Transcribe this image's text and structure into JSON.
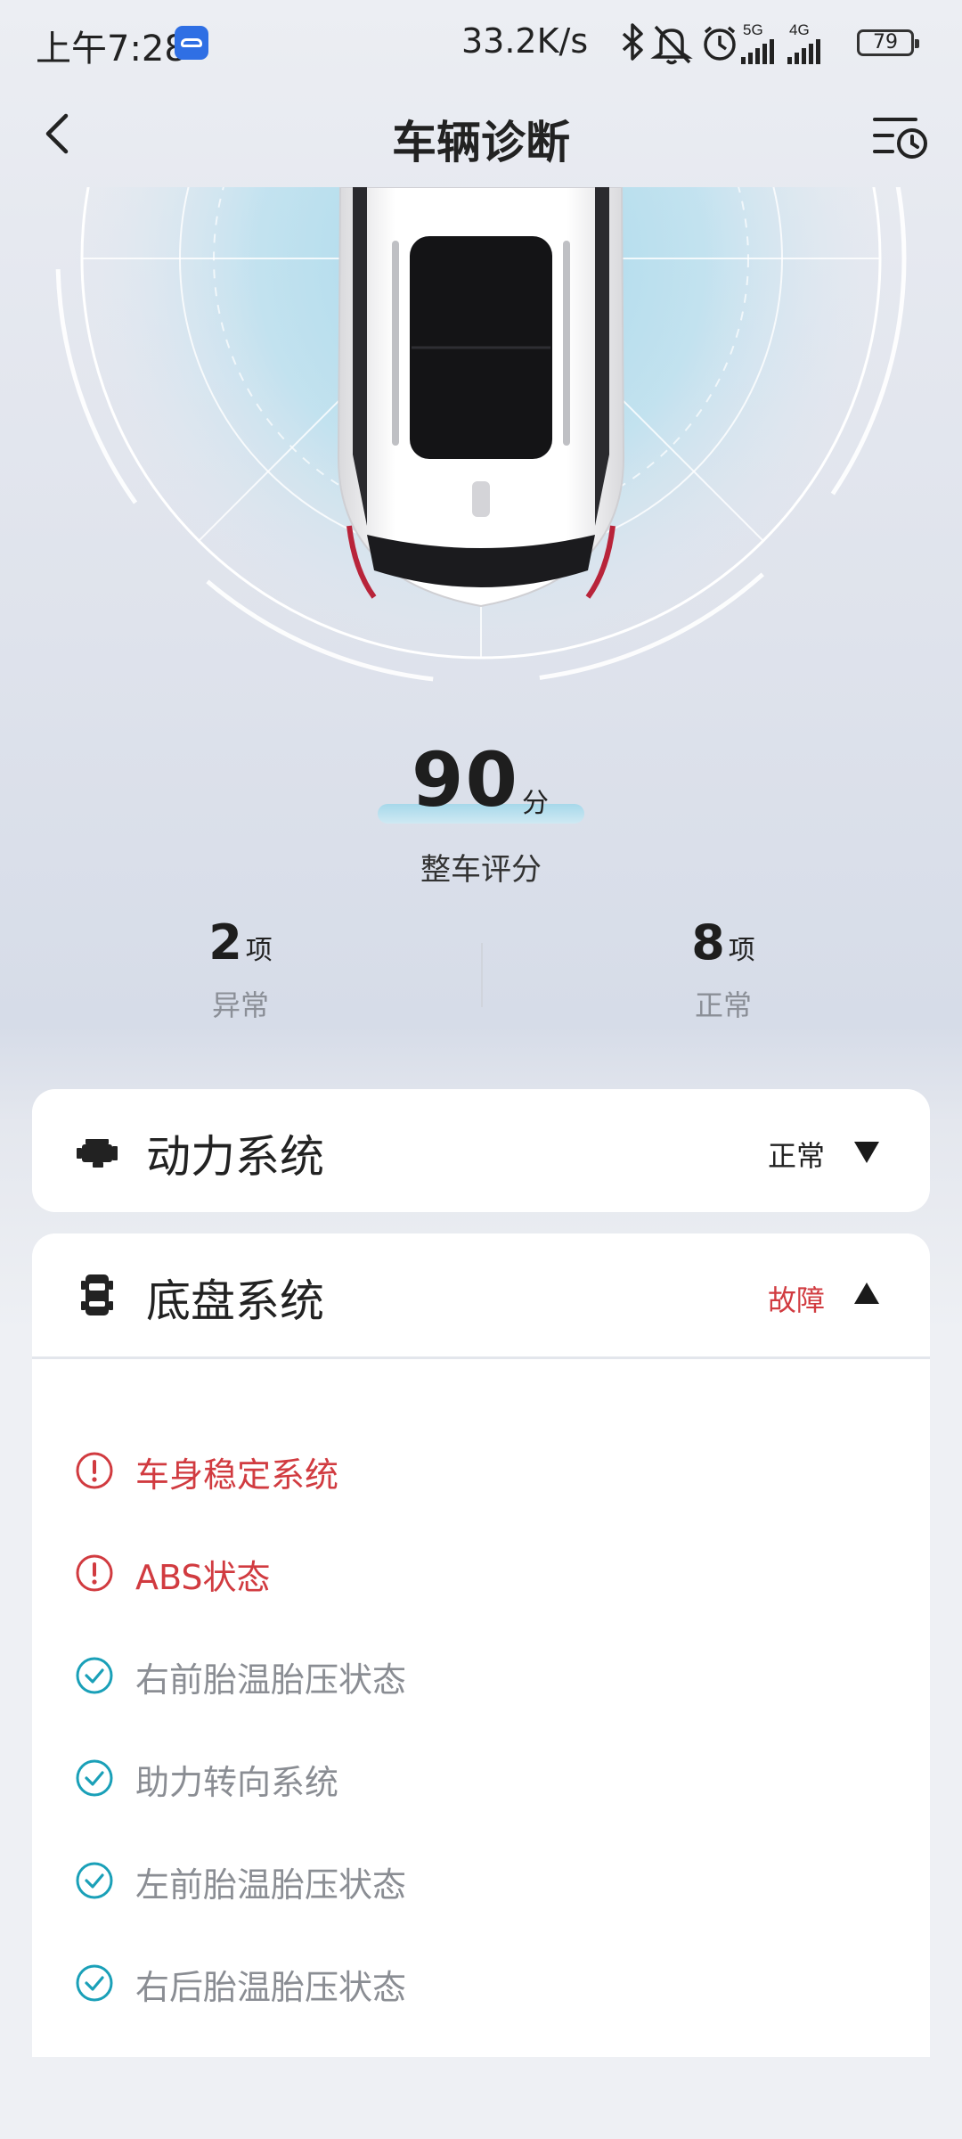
{
  "status_bar": {
    "time": "上午7:28",
    "speed": "33.2K/s",
    "network_5g": "5G",
    "network_4g": "4G",
    "battery": "79"
  },
  "header": {
    "title": "车辆诊断",
    "back_icon": "chevron-left-icon",
    "history_icon": "list-clock-icon"
  },
  "score": {
    "value": "90",
    "unit": "分",
    "label": "整车评分"
  },
  "stats": {
    "abnormal": {
      "count": "2",
      "unit": "项",
      "label": "异常"
    },
    "normal": {
      "count": "8",
      "unit": "项",
      "label": "正常"
    }
  },
  "systems": [
    {
      "name": "动力系统",
      "status": "正常",
      "status_color": "#222222",
      "icon": "engine-icon",
      "expanded": false
    },
    {
      "name": "底盘系统",
      "status": "故障",
      "status_color": "#d13b40",
      "icon": "chassis-icon",
      "expanded": true,
      "items": [
        {
          "label": "车身稳定系统",
          "state": "fault"
        },
        {
          "label": "ABS状态",
          "state": "fault"
        },
        {
          "label": "右前胎温胎压状态",
          "state": "ok"
        },
        {
          "label": "助力转向系统",
          "state": "ok"
        },
        {
          "label": "左前胎温胎压状态",
          "state": "ok"
        },
        {
          "label": "右后胎温胎压状态",
          "state": "ok"
        }
      ]
    }
  ],
  "colors": {
    "fault": "#d13b40",
    "ok": "#1aa0b8",
    "accent_glow": "#a6d8ea"
  }
}
